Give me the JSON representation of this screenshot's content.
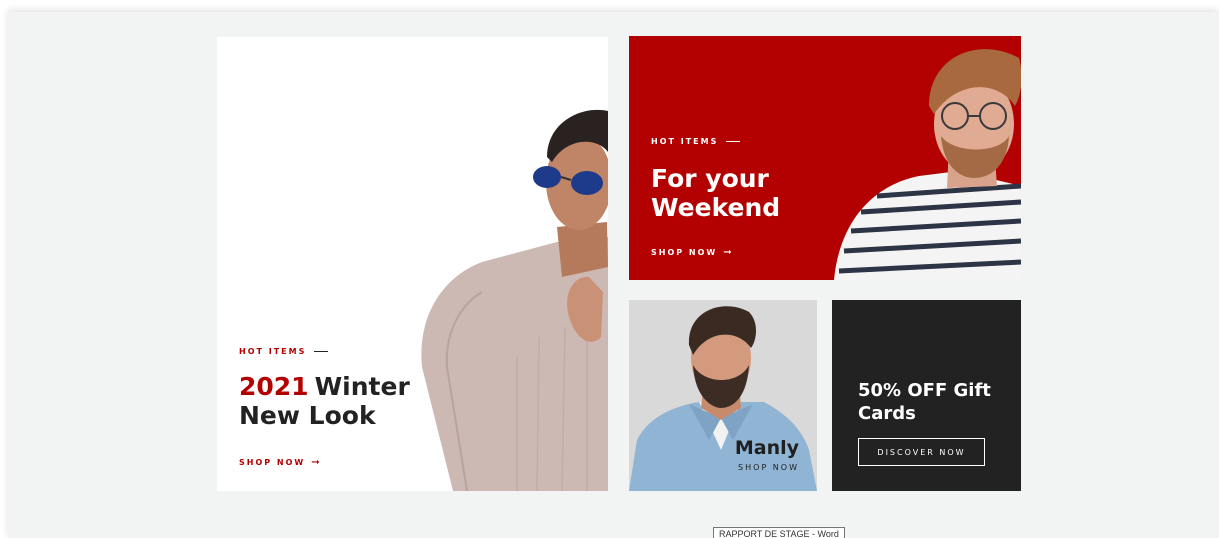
{
  "banners": {
    "winter": {
      "eyebrow": "HOT ITEMS",
      "year": "2021",
      "title_rest": "Winter",
      "title_line2": "New Look",
      "cta": "SHOP NOW",
      "arrow": "➞"
    },
    "weekend": {
      "eyebrow": "HOT ITEMS",
      "title_line1": "For your",
      "title_line2": "Weekend",
      "cta": "SHOP NOW",
      "arrow": "➞"
    },
    "manly": {
      "title": "Manly",
      "cta": "SHOP NOW"
    },
    "gift": {
      "title_line1": "50% OFF Gift",
      "title_line2": "Cards",
      "cta": "DISCOVER NOW"
    }
  },
  "taskbar": {
    "tooltip": "RAPPORT DE STAGE - Word"
  },
  "colors": {
    "accent_red": "#b30000",
    "dark": "#222222",
    "background": "#f1f4f3"
  }
}
